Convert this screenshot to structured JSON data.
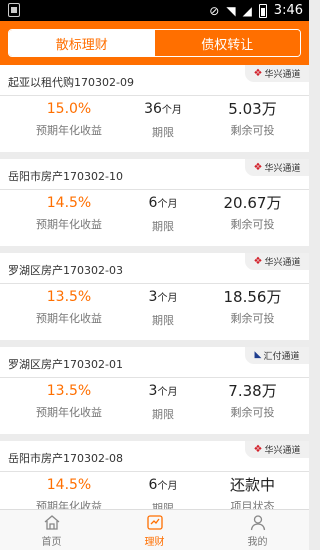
{
  "status_bar": {
    "time": "3:46",
    "icons": [
      "notification-icon",
      "no-sim-icon",
      "wifi-icon",
      "signal-icon",
      "battery-icon"
    ]
  },
  "tabs": [
    {
      "label": "散标理财",
      "active": false
    },
    {
      "label": "债权转让",
      "active": true
    }
  ],
  "products": [
    {
      "name": "起亚以租代购170302-09",
      "channel": "华兴通道",
      "channel_icon": "huaxing-logo-icon",
      "rate": "15.0%",
      "rate_label": "预期年化收益",
      "term": "36",
      "term_unit": "个月",
      "term_label": "期限",
      "remaining": "5.03万",
      "remaining_label": "剩余可投"
    },
    {
      "name": "岳阳市房产170302-10",
      "channel": "华兴通道",
      "channel_icon": "huaxing-logo-icon",
      "rate": "14.5%",
      "rate_label": "预期年化收益",
      "term": "6",
      "term_unit": "个月",
      "term_label": "期限",
      "remaining": "20.67万",
      "remaining_label": "剩余可投"
    },
    {
      "name": "罗湖区房产170302-03",
      "channel": "华兴通道",
      "channel_icon": "huaxing-logo-icon",
      "rate": "13.5%",
      "rate_label": "预期年化收益",
      "term": "3",
      "term_unit": "个月",
      "term_label": "期限",
      "remaining": "18.56万",
      "remaining_label": "剩余可投"
    },
    {
      "name": "罗湖区房产170302-01",
      "channel": "汇付通道",
      "channel_icon": "huifu-logo-icon",
      "rate": "13.5%",
      "rate_label": "预期年化收益",
      "term": "3",
      "term_unit": "个月",
      "term_label": "期限",
      "remaining": "7.38万",
      "remaining_label": "剩余可投"
    },
    {
      "name": "岳阳市房产170302-08",
      "channel": "华兴通道",
      "channel_icon": "huaxing-logo-icon",
      "rate": "14.5%",
      "rate_label": "预期年化收益",
      "term": "6",
      "term_unit": "个月",
      "term_label": "期限",
      "remaining": "还款中",
      "remaining_label": "项目状态"
    }
  ],
  "bottom_nav": [
    {
      "label": "首页",
      "icon": "home-icon",
      "active": false
    },
    {
      "label": "理财",
      "icon": "invest-icon",
      "active": true
    },
    {
      "label": "我的",
      "icon": "user-icon",
      "active": false
    }
  ],
  "colors": {
    "accent": "#ff6f00",
    "background": "#ececec",
    "huaxing_red": "#d3202a",
    "huifu_blue": "#1f3e8f"
  }
}
